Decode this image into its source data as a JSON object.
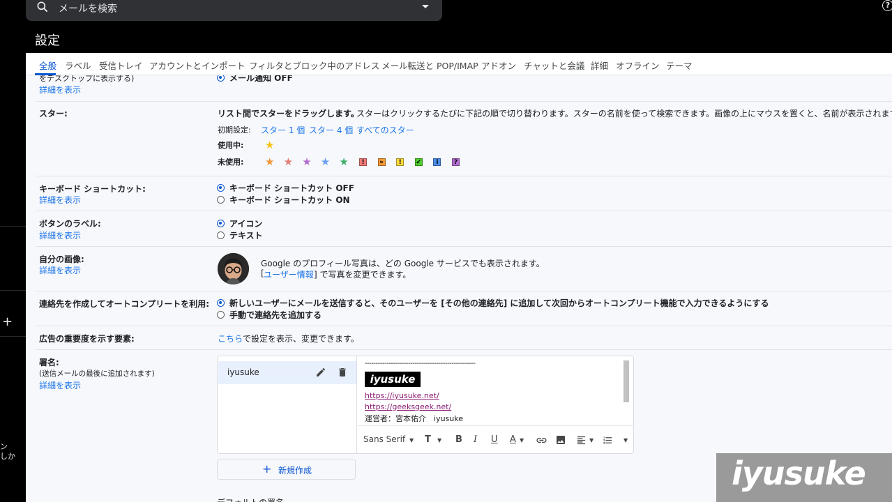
{
  "search": {
    "placeholder": "メールを検索"
  },
  "page_title": "設定",
  "left_rail": {
    "plus": "+",
    "text": "ン\nしか"
  },
  "tabs": [
    {
      "label": "全般",
      "active": true
    },
    {
      "label": "ラベル"
    },
    {
      "label": "受信トレイ"
    },
    {
      "label": "アカウントとインポート"
    },
    {
      "label": "フィルタとブロック中のアドレス"
    },
    {
      "label": "メール転送と POP/IMAP"
    },
    {
      "label": "アドオン"
    },
    {
      "label": "チャットと会議"
    },
    {
      "label": "詳細"
    },
    {
      "label": "オフライン"
    },
    {
      "label": "テーマ"
    }
  ],
  "notify_partial": {
    "label_partial": "をデスクトップに表示する)",
    "details": "詳細を表示",
    "option": "メール通知 OFF"
  },
  "stars": {
    "label": "スター:",
    "description_bold": "リスト間でスターをドラッグします。",
    "description": "スターはクリックするたびに下記の順で切り替わります。スターの名前を使って検索できます。画像の上にマウスを置くと、名前が表示されます。",
    "preset_label": "初期設定:",
    "presets": [
      "スター 1 個",
      "スター 4 個",
      "すべてのスター"
    ],
    "in_use_label": "使用中:",
    "unused_label": "未使用:",
    "in_use_icons": [
      {
        "name": "yellow-star-icon",
        "color": "#f4c20d"
      }
    ],
    "unused_icons": [
      {
        "name": "orange-star-icon",
        "type": "star",
        "color": "#f09636"
      },
      {
        "name": "red-star-icon",
        "type": "star",
        "color": "#e37b74"
      },
      {
        "name": "purple-star-icon",
        "type": "star",
        "color": "#b46ad1"
      },
      {
        "name": "blue-star-icon",
        "type": "star",
        "color": "#6aa1f5"
      },
      {
        "name": "green-star-icon",
        "type": "star",
        "color": "#3fae6b"
      },
      {
        "name": "red-bang-icon",
        "type": "square",
        "color": "#f37a7a",
        "glyph": "!"
      },
      {
        "name": "orange-guillemet-icon",
        "type": "square",
        "color": "#f79a36",
        "glyph": "»"
      },
      {
        "name": "yellow-bang-icon",
        "type": "square",
        "color": "#ffd93d",
        "glyph": "!"
      },
      {
        "name": "green-check-icon",
        "type": "square",
        "color": "#4ccd2b",
        "glyph": "✔"
      },
      {
        "name": "blue-info-icon",
        "type": "square",
        "color": "#4a8eea",
        "glyph": "i"
      },
      {
        "name": "purple-question-icon",
        "type": "square",
        "color": "#b46ad1",
        "glyph": "?"
      }
    ]
  },
  "shortcuts": {
    "label": "キーボード ショートカット:",
    "details": "詳細を表示",
    "options": [
      "キーボード ショートカット OFF",
      "キーボード ショートカット ON"
    ],
    "selected": 0
  },
  "button_labels": {
    "label": "ボタンのラベル:",
    "details": "詳細を表示",
    "options": [
      "アイコン",
      "テキスト"
    ],
    "selected": 0
  },
  "my_picture": {
    "label": "自分の画像:",
    "details": "詳細を表示",
    "line1": "Google のプロフィール写真は、どの Google サービスでも表示されます。",
    "line2_pre": "[",
    "line2_link": "ユーザー情報",
    "line2_post": "] で写真を変更できます。"
  },
  "autocomplete": {
    "label": "連絡先を作成してオートコンプリートを利用:",
    "options": [
      "新しいユーザーにメールを送信すると、そのユーザーを [その他の連絡先] に追加して次回からオートコンプリート機能で入力できるようにする",
      "手動で連絡先を追加する"
    ],
    "selected": 0
  },
  "ads": {
    "label": "広告の重要度を示す要素:",
    "link": "こちら",
    "text": "で設定を表示、変更できます。"
  },
  "signature": {
    "label": "署名:",
    "note": "(送信メールの最後に追加されます)",
    "details": "詳細を表示",
    "name": "iyusuke",
    "content": {
      "dashes": "---------------------------------------------------",
      "logo_text": "iyusuke",
      "url1": "https://iyusuke.net/",
      "url2": "https://geeksgeek.net/",
      "operator": "運営者：宮本佑介　iyusuke"
    },
    "toolbar": {
      "font": "Sans Serif",
      "size_glyph": "T",
      "bold": "B",
      "italic": "I",
      "underline": "U",
      "color": "A"
    },
    "new_button": "新規作成",
    "default_label": "デフォルトの署名"
  },
  "watermark": "iyusuke"
}
